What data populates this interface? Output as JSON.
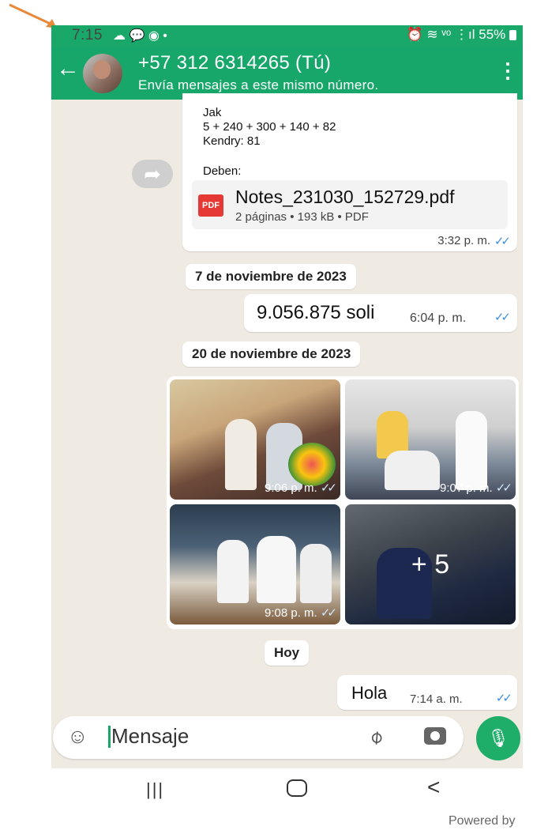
{
  "status_bar": {
    "time": "7:15",
    "left_icons": "☁ 💬 ◉ •",
    "right_icons": "⏰ ≋ ᵛᵒ ⋮ıl",
    "battery": "55%"
  },
  "header": {
    "contact": "+57 312 6314265 (Tú)",
    "subtitle": "Envía mensajes a este mismo número."
  },
  "message_pdf": {
    "line1": "Jak",
    "line2": "5 + 240 + 300 + 140 + 82",
    "line3": "Kendry: 81",
    "line4": "Deben:",
    "pdf_badge": "PDF",
    "file_name": "Notes_231030_152729.pdf",
    "file_meta": "2 páginas • 193 kB • PDF",
    "time": "3:32 p. m."
  },
  "date_chip_1": "7 de noviembre de 2023",
  "message_soli": {
    "text": "9.056.875 soli",
    "time": "6:04 p. m."
  },
  "date_chip_2": "20 de noviembre de 2023",
  "photos": [
    {
      "time": "9:06 p. m."
    },
    {
      "time": "9:07 p. m."
    },
    {
      "time": "9:08 p. m."
    },
    {
      "more": "+ 5"
    }
  ],
  "date_chip_today": "Hoy",
  "message_hola": {
    "text": "Hola",
    "time": "7:14 a. m."
  },
  "composer": {
    "placeholder": "Mensaje"
  },
  "footer": {
    "powered": "Powered by"
  },
  "colors": {
    "header_green": "#18a76a",
    "tick_blue": "#3a8ee6",
    "annotation_orange": "#e8883b"
  }
}
